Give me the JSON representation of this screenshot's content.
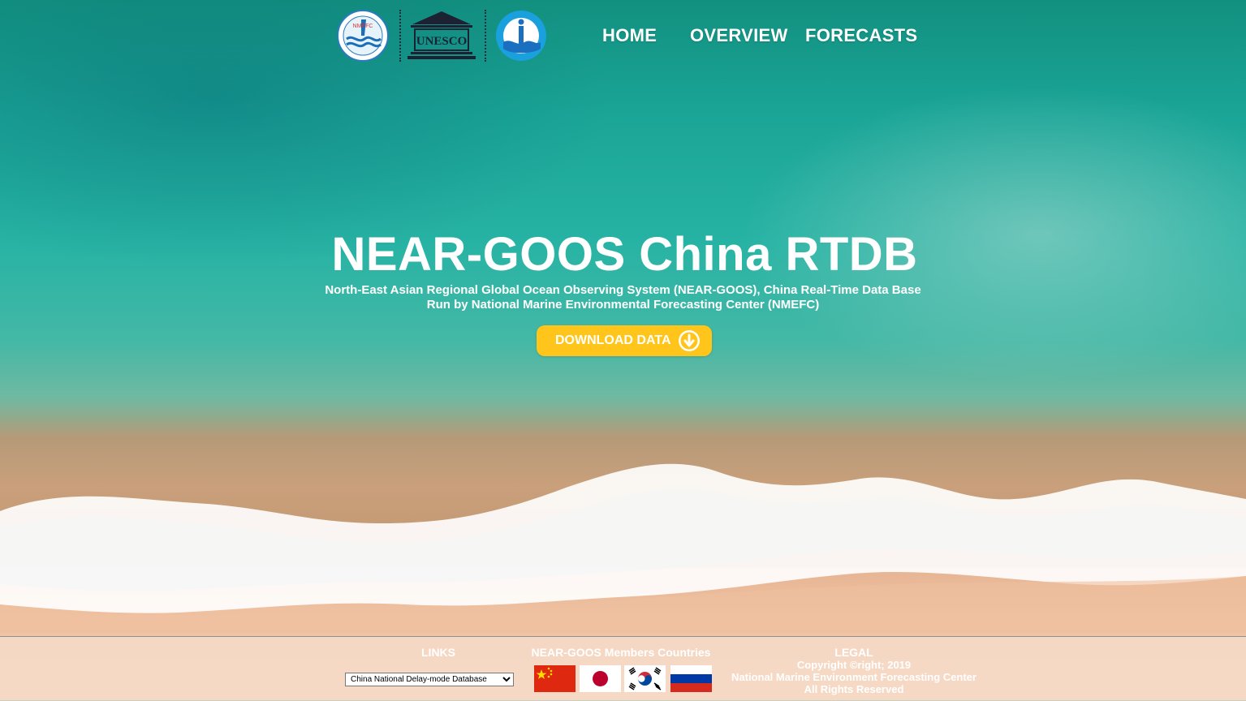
{
  "nav": {
    "home": "HOME",
    "overview": "OVERVIEW",
    "forecasts": "FORECASTS"
  },
  "logos": {
    "nmefc_text": "NMEFC",
    "unesco_text": "UNESCO"
  },
  "hero": {
    "title": "NEAR-GOOS China RTDB",
    "subtitle_line1": "North-East Asian Regional Global Ocean Observing System (NEAR-GOOS), China Real-Time Data Base",
    "subtitle_line2": "Run by National Marine Environmental Forecasting Center (NMEFC)",
    "download_label": "DOWNLOAD DATA"
  },
  "footer": {
    "links_heading": "LINKS",
    "links_select_value": "China National Delay-mode Database",
    "members_heading": "NEAR-GOOS Members Countries",
    "legal_heading": "LEGAL",
    "legal_line1": "Copyright ©right; 2019",
    "legal_line2": "National Marine Environment Forecasting Center",
    "legal_line3": "All Rights Reserved",
    "flags": [
      "China",
      "Japan",
      "Korea",
      "Russia"
    ]
  },
  "colors": {
    "accent_button": "#ffc51a",
    "ocean": "#1fa79b",
    "sand": "#efc2a2"
  }
}
